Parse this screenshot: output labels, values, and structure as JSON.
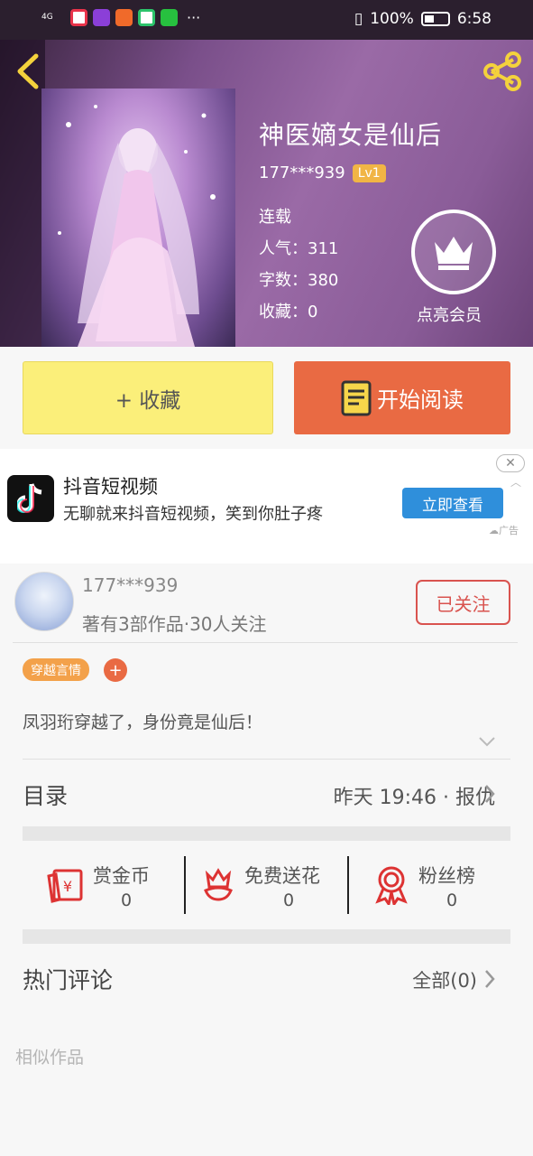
{
  "status_bar": {
    "network": "4G",
    "battery": "100%",
    "time": "6:58",
    "dots": "···"
  },
  "book": {
    "title": "神医嫡女是仙后",
    "author": "177***939",
    "level": "Lv1",
    "status": "连载",
    "popularity": "人气：311",
    "word_count": "字数：380",
    "favorites": "收藏：0",
    "vip_label": "点亮会员"
  },
  "actions": {
    "favorite_label": "+ 收藏",
    "read_label": "开始阅读"
  },
  "ad": {
    "title": "抖音短视频",
    "description": "无聊就来抖音短视频，笑到你肚子疼",
    "button": "立即查看",
    "close": "✕",
    "tag": "广告"
  },
  "author_info": {
    "name": "177***939",
    "stats": "著有3部作品·30人关注",
    "follow_label": "已关注"
  },
  "tags": [
    "穿越言情"
  ],
  "tag_add": "+",
  "description": "凤羽珩穿越了，身份竟是仙后！",
  "toc": {
    "label": "目录",
    "latest": "昨天 19:46 · 报仇"
  },
  "rewards": [
    {
      "label": "赏金币",
      "value": "0"
    },
    {
      "label": "免费送花",
      "value": "0"
    },
    {
      "label": "粉丝榜",
      "value": "0"
    }
  ],
  "comments": {
    "label": "热门评论",
    "all": "全部(0)"
  },
  "similar_label": "相似作品",
  "colors": {
    "accent_orange": "#e96a43",
    "favorite_yellow": "#fbef7a",
    "level_badge": "#f1b545",
    "follow_red": "#d9534f",
    "ad_button_blue": "#2f8fdb"
  }
}
